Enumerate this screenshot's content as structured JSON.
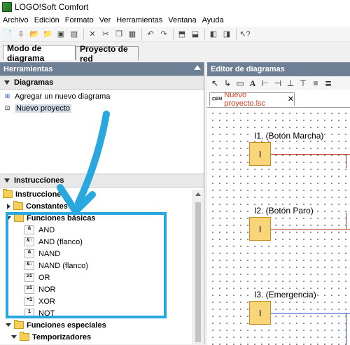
{
  "window": {
    "title": "LOGO!Soft Comfort"
  },
  "menu": [
    "Archivo",
    "Edición",
    "Formato",
    "Ver",
    "Herramientas",
    "Ventana",
    "Ayuda"
  ],
  "mode_tabs": {
    "diagram": "Modo de diagrama",
    "network": "Proyecto de red"
  },
  "tools_panel": {
    "title": "Herramientas",
    "diagrams_section": "Diagramas",
    "diagram_items": [
      {
        "label": "Agregar un nuevo diagrama"
      },
      {
        "label": "Nuevo proyecto"
      }
    ],
    "instructions_section": "Instrucciones",
    "tree": {
      "root": "Instrucciones",
      "constants": "Constantes",
      "basic_functions": "Funciones básicas",
      "gates": [
        {
          "glyph": "&",
          "label": "AND"
        },
        {
          "glyph": "&↑",
          "label": "AND (flanco)"
        },
        {
          "glyph": "&",
          "label": "NAND"
        },
        {
          "glyph": "&↓",
          "label": "NAND (flanco)"
        },
        {
          "glyph": "≥1",
          "label": "OR"
        },
        {
          "glyph": "≥1",
          "label": "NOR"
        },
        {
          "glyph": "=1",
          "label": "XOR"
        },
        {
          "glyph": "1",
          "label": "NOT"
        }
      ],
      "special_functions": "Funciones especiales",
      "timers": "Temporizadores"
    }
  },
  "editor": {
    "title": "Editor de diagramas",
    "tab_label": "Nuevo proyecto.lsc",
    "blocks": [
      {
        "label": "I1. (Botón Marcha)",
        "text": "I"
      },
      {
        "label": "I2. (Botón Paro)",
        "text": "I"
      },
      {
        "label": "I3. (Emergencia)",
        "text": "I"
      }
    ]
  },
  "colors": {
    "panel_header": "#6d7f95",
    "highlight": "#29a8e0",
    "input_block": "#f8d579",
    "wire_red": "#c0392b",
    "wire_blue": "#2a57c5",
    "tab_text": "#d43b1f"
  }
}
